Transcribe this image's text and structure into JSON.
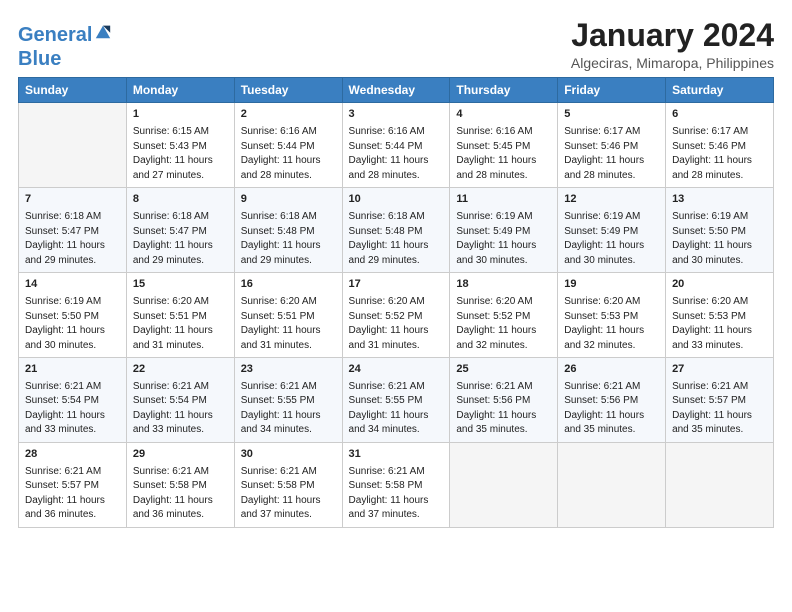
{
  "logo": {
    "line1": "General",
    "line2": "Blue"
  },
  "title": "January 2024",
  "subtitle": "Algeciras, Mimaropa, Philippines",
  "days_of_week": [
    "Sunday",
    "Monday",
    "Tuesday",
    "Wednesday",
    "Thursday",
    "Friday",
    "Saturday"
  ],
  "weeks": [
    [
      {
        "day": "",
        "info": ""
      },
      {
        "day": "1",
        "info": "Sunrise: 6:15 AM\nSunset: 5:43 PM\nDaylight: 11 hours\nand 27 minutes."
      },
      {
        "day": "2",
        "info": "Sunrise: 6:16 AM\nSunset: 5:44 PM\nDaylight: 11 hours\nand 28 minutes."
      },
      {
        "day": "3",
        "info": "Sunrise: 6:16 AM\nSunset: 5:44 PM\nDaylight: 11 hours\nand 28 minutes."
      },
      {
        "day": "4",
        "info": "Sunrise: 6:16 AM\nSunset: 5:45 PM\nDaylight: 11 hours\nand 28 minutes."
      },
      {
        "day": "5",
        "info": "Sunrise: 6:17 AM\nSunset: 5:46 PM\nDaylight: 11 hours\nand 28 minutes."
      },
      {
        "day": "6",
        "info": "Sunrise: 6:17 AM\nSunset: 5:46 PM\nDaylight: 11 hours\nand 28 minutes."
      }
    ],
    [
      {
        "day": "7",
        "info": "Sunrise: 6:18 AM\nSunset: 5:47 PM\nDaylight: 11 hours\nand 29 minutes."
      },
      {
        "day": "8",
        "info": "Sunrise: 6:18 AM\nSunset: 5:47 PM\nDaylight: 11 hours\nand 29 minutes."
      },
      {
        "day": "9",
        "info": "Sunrise: 6:18 AM\nSunset: 5:48 PM\nDaylight: 11 hours\nand 29 minutes."
      },
      {
        "day": "10",
        "info": "Sunrise: 6:18 AM\nSunset: 5:48 PM\nDaylight: 11 hours\nand 29 minutes."
      },
      {
        "day": "11",
        "info": "Sunrise: 6:19 AM\nSunset: 5:49 PM\nDaylight: 11 hours\nand 30 minutes."
      },
      {
        "day": "12",
        "info": "Sunrise: 6:19 AM\nSunset: 5:49 PM\nDaylight: 11 hours\nand 30 minutes."
      },
      {
        "day": "13",
        "info": "Sunrise: 6:19 AM\nSunset: 5:50 PM\nDaylight: 11 hours\nand 30 minutes."
      }
    ],
    [
      {
        "day": "14",
        "info": "Sunrise: 6:19 AM\nSunset: 5:50 PM\nDaylight: 11 hours\nand 30 minutes."
      },
      {
        "day": "15",
        "info": "Sunrise: 6:20 AM\nSunset: 5:51 PM\nDaylight: 11 hours\nand 31 minutes."
      },
      {
        "day": "16",
        "info": "Sunrise: 6:20 AM\nSunset: 5:51 PM\nDaylight: 11 hours\nand 31 minutes."
      },
      {
        "day": "17",
        "info": "Sunrise: 6:20 AM\nSunset: 5:52 PM\nDaylight: 11 hours\nand 31 minutes."
      },
      {
        "day": "18",
        "info": "Sunrise: 6:20 AM\nSunset: 5:52 PM\nDaylight: 11 hours\nand 32 minutes."
      },
      {
        "day": "19",
        "info": "Sunrise: 6:20 AM\nSunset: 5:53 PM\nDaylight: 11 hours\nand 32 minutes."
      },
      {
        "day": "20",
        "info": "Sunrise: 6:20 AM\nSunset: 5:53 PM\nDaylight: 11 hours\nand 33 minutes."
      }
    ],
    [
      {
        "day": "21",
        "info": "Sunrise: 6:21 AM\nSunset: 5:54 PM\nDaylight: 11 hours\nand 33 minutes."
      },
      {
        "day": "22",
        "info": "Sunrise: 6:21 AM\nSunset: 5:54 PM\nDaylight: 11 hours\nand 33 minutes."
      },
      {
        "day": "23",
        "info": "Sunrise: 6:21 AM\nSunset: 5:55 PM\nDaylight: 11 hours\nand 34 minutes."
      },
      {
        "day": "24",
        "info": "Sunrise: 6:21 AM\nSunset: 5:55 PM\nDaylight: 11 hours\nand 34 minutes."
      },
      {
        "day": "25",
        "info": "Sunrise: 6:21 AM\nSunset: 5:56 PM\nDaylight: 11 hours\nand 35 minutes."
      },
      {
        "day": "26",
        "info": "Sunrise: 6:21 AM\nSunset: 5:56 PM\nDaylight: 11 hours\nand 35 minutes."
      },
      {
        "day": "27",
        "info": "Sunrise: 6:21 AM\nSunset: 5:57 PM\nDaylight: 11 hours\nand 35 minutes."
      }
    ],
    [
      {
        "day": "28",
        "info": "Sunrise: 6:21 AM\nSunset: 5:57 PM\nDaylight: 11 hours\nand 36 minutes."
      },
      {
        "day": "29",
        "info": "Sunrise: 6:21 AM\nSunset: 5:58 PM\nDaylight: 11 hours\nand 36 minutes."
      },
      {
        "day": "30",
        "info": "Sunrise: 6:21 AM\nSunset: 5:58 PM\nDaylight: 11 hours\nand 37 minutes."
      },
      {
        "day": "31",
        "info": "Sunrise: 6:21 AM\nSunset: 5:58 PM\nDaylight: 11 hours\nand 37 minutes."
      },
      {
        "day": "",
        "info": ""
      },
      {
        "day": "",
        "info": ""
      },
      {
        "day": "",
        "info": ""
      }
    ]
  ]
}
